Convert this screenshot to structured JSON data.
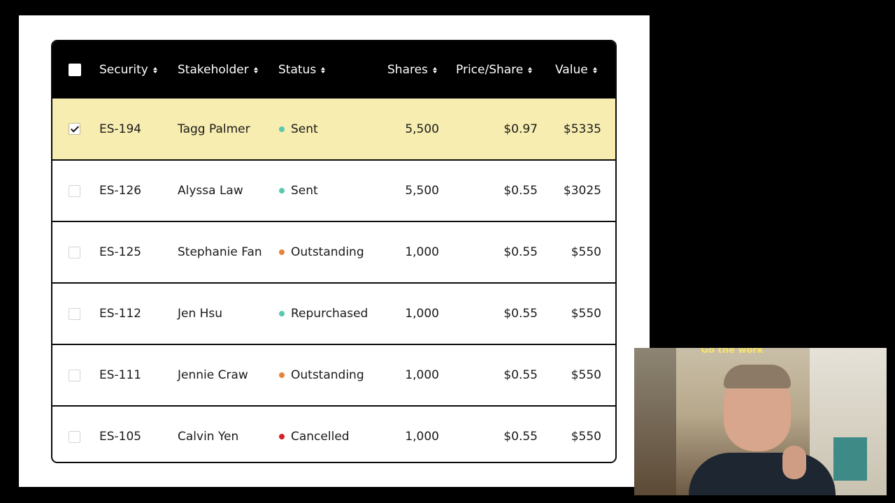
{
  "table": {
    "columns": [
      {
        "key": "security",
        "label": "Security"
      },
      {
        "key": "stakeholder",
        "label": "Stakeholder"
      },
      {
        "key": "status",
        "label": "Status"
      },
      {
        "key": "shares",
        "label": "Shares"
      },
      {
        "key": "price",
        "label": "Price/Share"
      },
      {
        "key": "value",
        "label": "Value"
      }
    ],
    "rows": [
      {
        "checked": true,
        "security": "ES-194",
        "stakeholder": "Tagg Palmer",
        "status": "Sent",
        "status_color": "#5ac8b0",
        "shares": "5,500",
        "price": "$0.97",
        "value": "$5335"
      },
      {
        "checked": false,
        "security": "ES-126",
        "stakeholder": "Alyssa Law",
        "status": "Sent",
        "status_color": "#5ac8b0",
        "shares": "5,500",
        "price": "$0.55",
        "value": "$3025"
      },
      {
        "checked": false,
        "security": "ES-125",
        "stakeholder": "Stephanie Fan",
        "status": "Outstanding",
        "status_color": "#e8833a",
        "shares": "1,000",
        "price": "$0.55",
        "value": "$550"
      },
      {
        "checked": false,
        "security": "ES-112",
        "stakeholder": "Jen Hsu",
        "status": "Repurchased",
        "status_color": "#5ac8b0",
        "shares": "1,000",
        "price": "$0.55",
        "value": "$550"
      },
      {
        "checked": false,
        "security": "ES-111",
        "stakeholder": "Jennie Craw",
        "status": "Outstanding",
        "status_color": "#e8833a",
        "shares": "1,000",
        "price": "$0.55",
        "value": "$550"
      },
      {
        "checked": false,
        "security": "ES-105",
        "stakeholder": "Calvin Yen",
        "status": "Cancelled",
        "status_color": "#d8202b",
        "shares": "1,000",
        "price": "$0.55",
        "value": "$550"
      }
    ],
    "selected_row_color": "#f7edb0"
  },
  "webcam": {
    "neon_text": "Go the work"
  }
}
